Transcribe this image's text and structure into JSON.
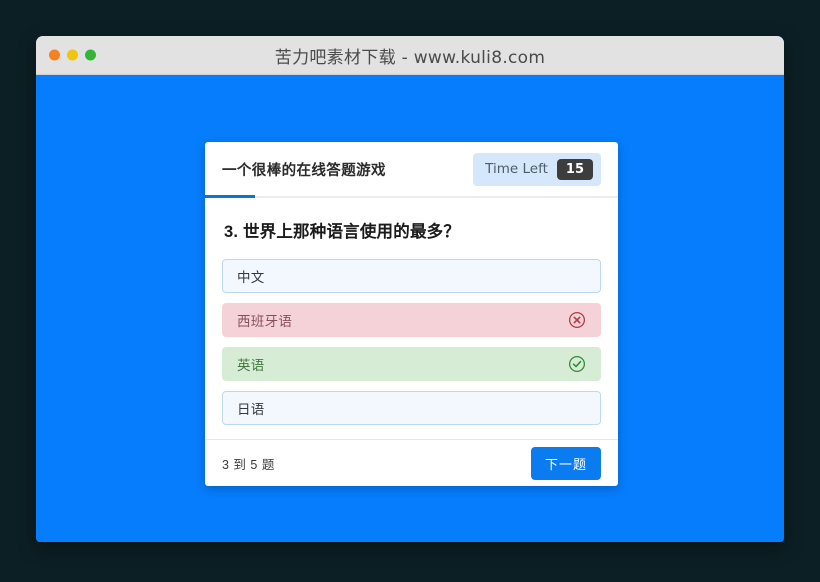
{
  "window": {
    "title": "苦力吧素材下载 - www.kuli8.com",
    "traffic_lights": [
      {
        "name": "close",
        "color": "#f58220"
      },
      {
        "name": "minimize",
        "color": "#f1c40f"
      },
      {
        "name": "maximize",
        "color": "#36b534"
      }
    ]
  },
  "theme": {
    "desktop_bg": "#0c1f24",
    "page_bg": "#067dfc",
    "accent": "#0a7cf0",
    "titlebar_bg": "#e2e2e2",
    "correct": "#d6ecd4",
    "wrong": "#f5d2d8",
    "neutral": "#f2f8fd"
  },
  "card": {
    "header": {
      "title": "一个很棒的在线答题游戏",
      "timer": {
        "label": "Time Left",
        "value": "15"
      }
    },
    "question": {
      "text": "3. 世界上那种语言使用的最多？"
    },
    "options": [
      {
        "label": "中文",
        "state": "neutral",
        "icon": ""
      },
      {
        "label": "西班牙语",
        "state": "wrong",
        "icon": "x-circle-icon"
      },
      {
        "label": "英语",
        "state": "correct",
        "icon": "check-circle-icon"
      },
      {
        "label": "日语",
        "state": "neutral",
        "icon": ""
      }
    ],
    "footer": {
      "progress": "3 到 5 题",
      "next_label": "下一题"
    }
  }
}
